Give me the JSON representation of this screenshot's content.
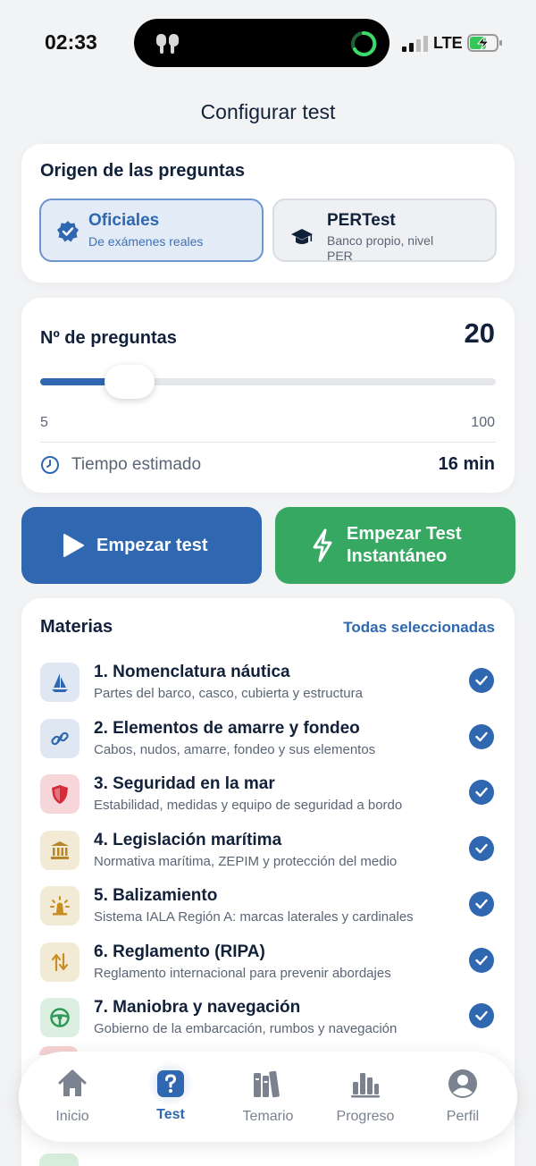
{
  "status": {
    "time": "02:33",
    "network": "LTE"
  },
  "header": {
    "title": "Configurar test"
  },
  "origin": {
    "heading": "Origen de las preguntas",
    "options": [
      {
        "title": "Oficiales",
        "subtitle": "De exámenes reales",
        "selected": true,
        "icon": "verified-badge-icon"
      },
      {
        "title": "PERTest",
        "subtitle": "Banco propio, nivel PER",
        "selected": false,
        "icon": "graduation-cap-icon"
      }
    ]
  },
  "questions": {
    "heading": "Nº de preguntas",
    "value": "20",
    "numeric_value": 20,
    "min": "5",
    "max": "100",
    "estimate_label": "Tiempo estimado",
    "estimate_value": "16 min"
  },
  "actions": {
    "start_label": "Empezar test",
    "instant_label": "Empezar Test Instantáneo"
  },
  "subjects": {
    "heading": "Materias",
    "selection_label": "Todas seleccionadas",
    "items": [
      {
        "title": "1. Nomenclatura náutica",
        "desc": "Partes del barco, casco, cubierta y estructura",
        "icon": "sailboat-icon",
        "color": "#dfe7f3",
        "icon_color": "#2f68b0",
        "checked": true
      },
      {
        "title": "2. Elementos de amarre y fondeo",
        "desc": "Cabos, nudos, amarre, fondeo y sus elementos",
        "icon": "link-icon",
        "color": "#dfe7f3",
        "icon_color": "#2f68b0",
        "checked": true
      },
      {
        "title": "3. Seguridad en la mar",
        "desc": "Estabilidad, medidas y equipo de seguridad a bordo",
        "icon": "shield-icon",
        "color": "#f6d6d8",
        "icon_color": "#d62b3a",
        "checked": true
      },
      {
        "title": "4. Legislación marítima",
        "desc": "Normativa marítima, ZEPIM y protección del medio",
        "icon": "institution-icon",
        "color": "#f3ead6",
        "icon_color": "#b8862a",
        "checked": true
      },
      {
        "title": "5. Balizamiento",
        "desc": "Sistema IALA Región A: marcas laterales y cardinales",
        "icon": "beacon-icon",
        "color": "#f3ead6",
        "icon_color": "#c98e23",
        "checked": true
      },
      {
        "title": "6. Reglamento (RIPA)",
        "desc": "Reglamento internacional para prevenir abordajes",
        "icon": "arrows-swap-icon",
        "color": "#f3ead6",
        "icon_color": "#c98e23",
        "checked": true
      },
      {
        "title": "7. Maniobra y navegación",
        "desc": "Gobierno de la embarcación, rumbos y navegación",
        "icon": "steering-wheel-icon",
        "color": "#dcefe1",
        "icon_color": "#2e9a57",
        "checked": true
      }
    ]
  },
  "tabs": [
    {
      "label": "Inicio",
      "icon": "home-icon",
      "active": false
    },
    {
      "label": "Test",
      "icon": "question-icon",
      "active": true
    },
    {
      "label": "Temario",
      "icon": "books-icon",
      "active": false
    },
    {
      "label": "Progreso",
      "icon": "bar-chart-icon",
      "active": false
    },
    {
      "label": "Perfil",
      "icon": "person-icon",
      "active": false
    }
  ],
  "colors": {
    "primary": "#2f68b0",
    "success": "#36a862",
    "background": "#f2f3f5"
  }
}
